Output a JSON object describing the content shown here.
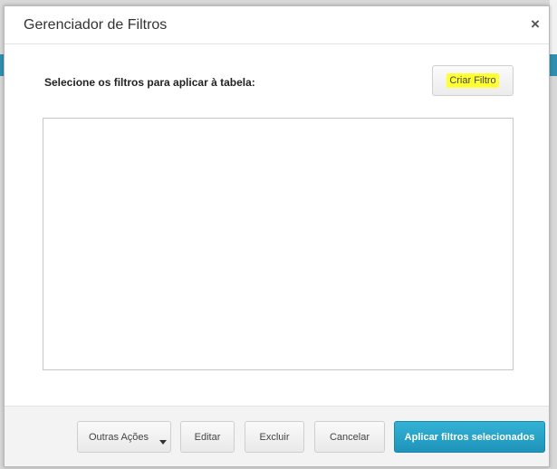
{
  "dialog": {
    "title": "Gerenciador de Filtros",
    "close_label": "×",
    "instruction": "Selecione os filtros para aplicar à tabela:",
    "create_filter_label": "Criar Filtro",
    "filters": []
  },
  "footer": {
    "other_actions_label": "Outras Ações",
    "edit_label": "Editar",
    "delete_label": "Excluir",
    "cancel_label": "Cancelar",
    "apply_label": "Aplicar filtros selecionados"
  },
  "colors": {
    "highlight": "#ffff33",
    "primary_button": "#25a2c8",
    "backdrop_accent": "#2f8fb0"
  },
  "icons": {
    "close": "close-icon",
    "dropdown": "caret-down-icon"
  }
}
